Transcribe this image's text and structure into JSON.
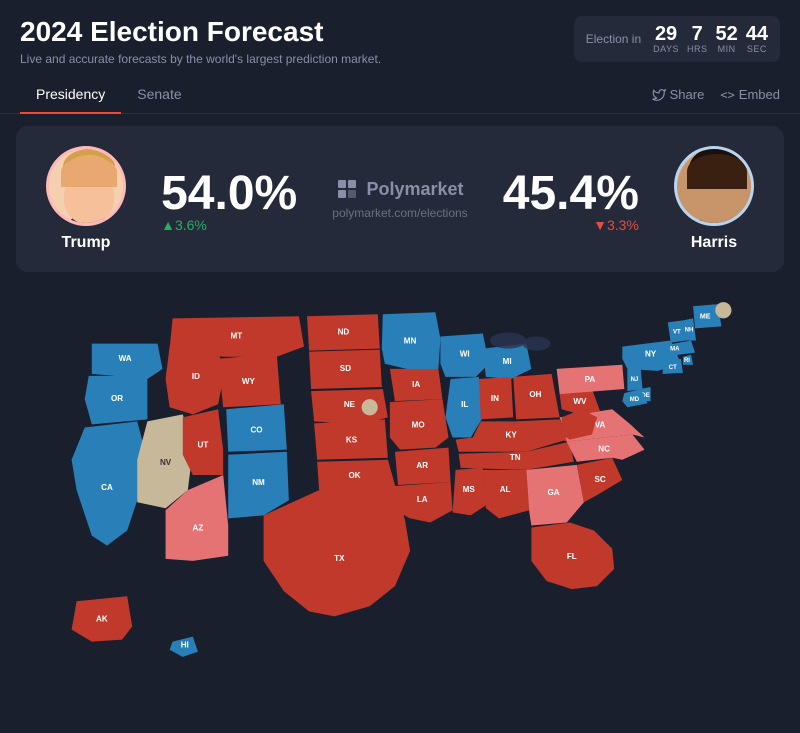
{
  "header": {
    "title": "2024 Election Forecast",
    "subtitle": "Live and accurate forecasts by the world's largest prediction market."
  },
  "countdown": {
    "label": "Election in",
    "days": {
      "value": "29",
      "unit": "DAYS"
    },
    "hours": {
      "value": "7",
      "unit": "HRS"
    },
    "minutes": {
      "value": "52",
      "unit": "MIN"
    },
    "seconds": {
      "value": "44",
      "unit": "SEC"
    }
  },
  "tabs": {
    "items": [
      "Presidency",
      "Senate"
    ],
    "active": "Presidency"
  },
  "actions": {
    "share": "Share",
    "embed": "Embed"
  },
  "candidates": {
    "trump": {
      "name": "Trump",
      "pct": "54.0%",
      "change": "▲3.6%",
      "direction": "up"
    },
    "harris": {
      "name": "Harris",
      "pct": "45.4%",
      "change": "▼3.3%",
      "direction": "down"
    }
  },
  "polymarket": {
    "name": "Polymarket",
    "url": "polymarket.com/elections"
  },
  "states": {
    "red": [
      "TX",
      "OK",
      "KS",
      "NE",
      "SD",
      "ND",
      "MO",
      "AR",
      "LA",
      "MS",
      "AL",
      "TN",
      "KY",
      "WV",
      "IN",
      "OH",
      "SC",
      "GA",
      "FL",
      "MT",
      "WY",
      "ID",
      "UT",
      "AK"
    ],
    "blue": [
      "CA",
      "OR",
      "WA",
      "CO",
      "NM",
      "MN",
      "WI",
      "MI",
      "IL",
      "NY",
      "VT",
      "NH",
      "MA",
      "RI",
      "CT",
      "NJ",
      "DE",
      "MD",
      "HI"
    ],
    "light_red": [
      "AZ",
      "NC",
      "VA",
      "PA"
    ],
    "light_blue": [
      "NV",
      "IA",
      "ME"
    ],
    "tan": [
      "Iowa"
    ]
  }
}
